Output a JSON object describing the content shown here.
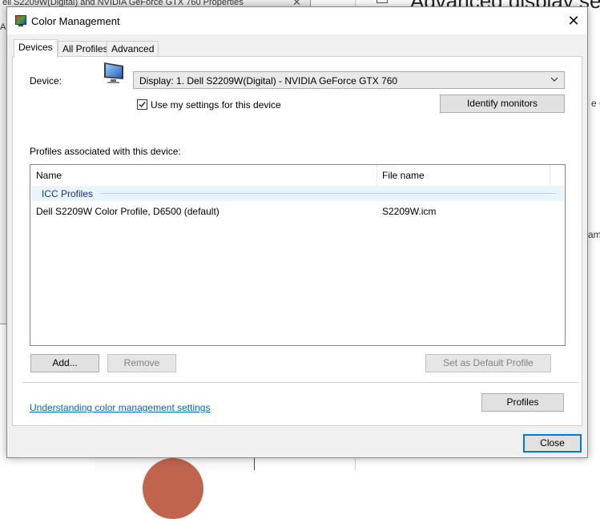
{
  "background": {
    "left_window_title": "ell S2209W(Digital) and NVIDIA GeForce GTX 760 Properties",
    "left_fragment_ac": "Ac",
    "right_heading": "Advanced display se",
    "right_fragment_g": "e G",
    "right_fragment_am": "am"
  },
  "dialog": {
    "title": "Color Management",
    "tabs": [
      "Devices",
      "All Profiles",
      "Advanced"
    ],
    "device_label": "Device:",
    "device_value": "Display: 1. Dell S2209W(Digital) - NVIDIA GeForce GTX 760",
    "use_settings_label": "Use my settings for this device",
    "use_settings_checked": true,
    "identify_button": "Identify monitors",
    "profiles_label": "Profiles associated with this device:",
    "list": {
      "columns": [
        "Name",
        "File name"
      ],
      "group": "ICC Profiles",
      "rows": [
        {
          "name": "Dell S2209W Color Profile, D6500 (default)",
          "file": "S2209W.icm"
        }
      ]
    },
    "add_button": "Add...",
    "remove_button": "Remove",
    "set_default_button": "Set as Default Profile",
    "profiles_button": "Profiles",
    "help_link": "Understanding color management settings",
    "close_button": "Close"
  }
}
